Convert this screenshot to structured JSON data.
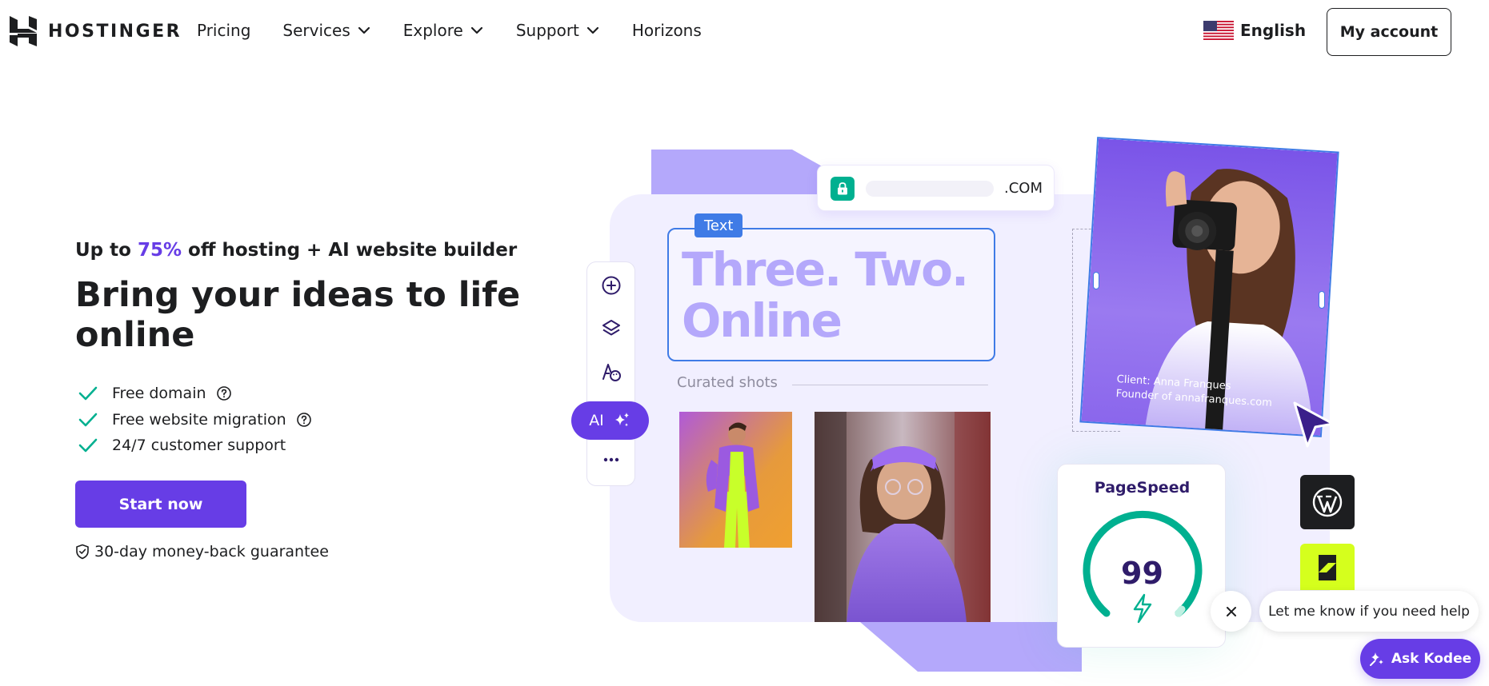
{
  "brand": {
    "name": "HOSTINGER",
    "accent": "#673de6"
  },
  "nav": {
    "items": [
      {
        "label": "Pricing",
        "has_dropdown": false
      },
      {
        "label": "Services",
        "has_dropdown": true
      },
      {
        "label": "Explore",
        "has_dropdown": true
      },
      {
        "label": "Support",
        "has_dropdown": true
      },
      {
        "label": "Horizons",
        "has_dropdown": false
      }
    ],
    "language": "English",
    "account_button": "My account"
  },
  "hero": {
    "promo_prefix": "Up to ",
    "promo_discount": "75%",
    "promo_suffix": " off hosting + AI website builder",
    "headline": "Bring your ideas to life online",
    "features": [
      {
        "text": "Free domain",
        "has_help": true
      },
      {
        "text": "Free website migration",
        "has_help": true
      },
      {
        "text": "24/7 customer support",
        "has_help": false
      }
    ],
    "cta": "Start now",
    "guarantee": "30-day money-back guarantee"
  },
  "builder_preview": {
    "domain_tld": ".COM",
    "text_tag": "Text",
    "text_content": "Three. Two. Online",
    "ai_label": "AI",
    "section_label": "Curated shots",
    "client_line1": "Client: Anna Franques",
    "client_line2": "Founder of annafranques.com",
    "pagespeed_title": "PageSpeed",
    "pagespeed_score": 99,
    "toolbar_icons": [
      "plus-circle-icon",
      "layers-icon",
      "palette-icon",
      "more-icon"
    ]
  },
  "chat": {
    "message": "Let me know if you need help",
    "button": "Ask Kodee"
  }
}
